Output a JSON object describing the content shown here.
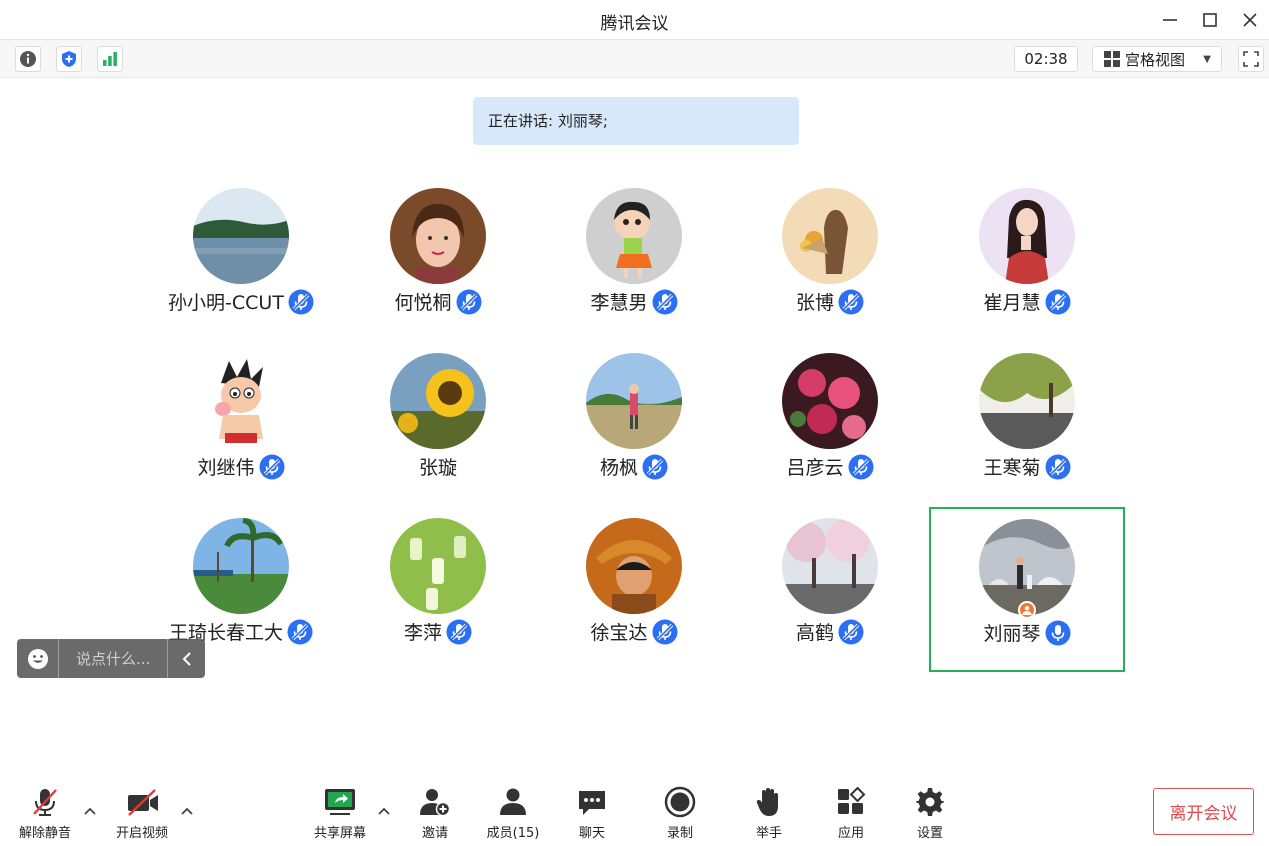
{
  "window": {
    "title": "腾讯会议"
  },
  "infobar": {
    "timer": "02:38",
    "view_mode": "宫格视图"
  },
  "speaking": {
    "text": "正在讲话: 刘丽琴;"
  },
  "participants": [
    {
      "name": "孙小明-CCUT",
      "mic": true,
      "avatar": "lake-landscape"
    },
    {
      "name": "何悦桐",
      "mic": true,
      "avatar": "woman-portrait"
    },
    {
      "name": "李慧男",
      "mic": true,
      "avatar": "cartoon-girl"
    },
    {
      "name": "张博",
      "mic": true,
      "avatar": "flowers-bouquet"
    },
    {
      "name": "崔月慧",
      "mic": true,
      "avatar": "illustrated-woman"
    },
    {
      "name": "刘继伟",
      "mic": true,
      "avatar": "astro-boy"
    },
    {
      "name": "张璇",
      "mic": false,
      "avatar": "sunflower"
    },
    {
      "name": "杨枫",
      "mic": true,
      "avatar": "person-field"
    },
    {
      "name": "吕彦云",
      "mic": true,
      "avatar": "pink-flowers"
    },
    {
      "name": "王寒菊",
      "mic": true,
      "avatar": "willow-lake"
    },
    {
      "name": "王琦长春工大",
      "mic": true,
      "avatar": "palm-beach"
    },
    {
      "name": "李萍",
      "mic": true,
      "avatar": "green-bottles"
    },
    {
      "name": "徐宝达",
      "mic": true,
      "avatar": "anime-pirate"
    },
    {
      "name": "高鹤",
      "mic": true,
      "avatar": "cherry-blossom"
    },
    {
      "name": "刘丽琴",
      "mic": true,
      "avatar": "family-park",
      "active": true,
      "host": true
    }
  ],
  "chat": {
    "placeholder": "说点什么..."
  },
  "toolbar": {
    "unmute": "解除静音",
    "start_video": "开启视频",
    "share_screen": "共享屏幕",
    "invite": "邀请",
    "members": "成员(15)",
    "chat": "聊天",
    "record": "录制",
    "raise_hand": "举手",
    "apps": "应用",
    "settings": "设置",
    "leave": "离开会议"
  },
  "colors": {
    "accent_blue": "#2b6ff3",
    "active_border": "#1fb25a",
    "leave_red": "#e04a4a",
    "banner": "#d8e8fb"
  }
}
